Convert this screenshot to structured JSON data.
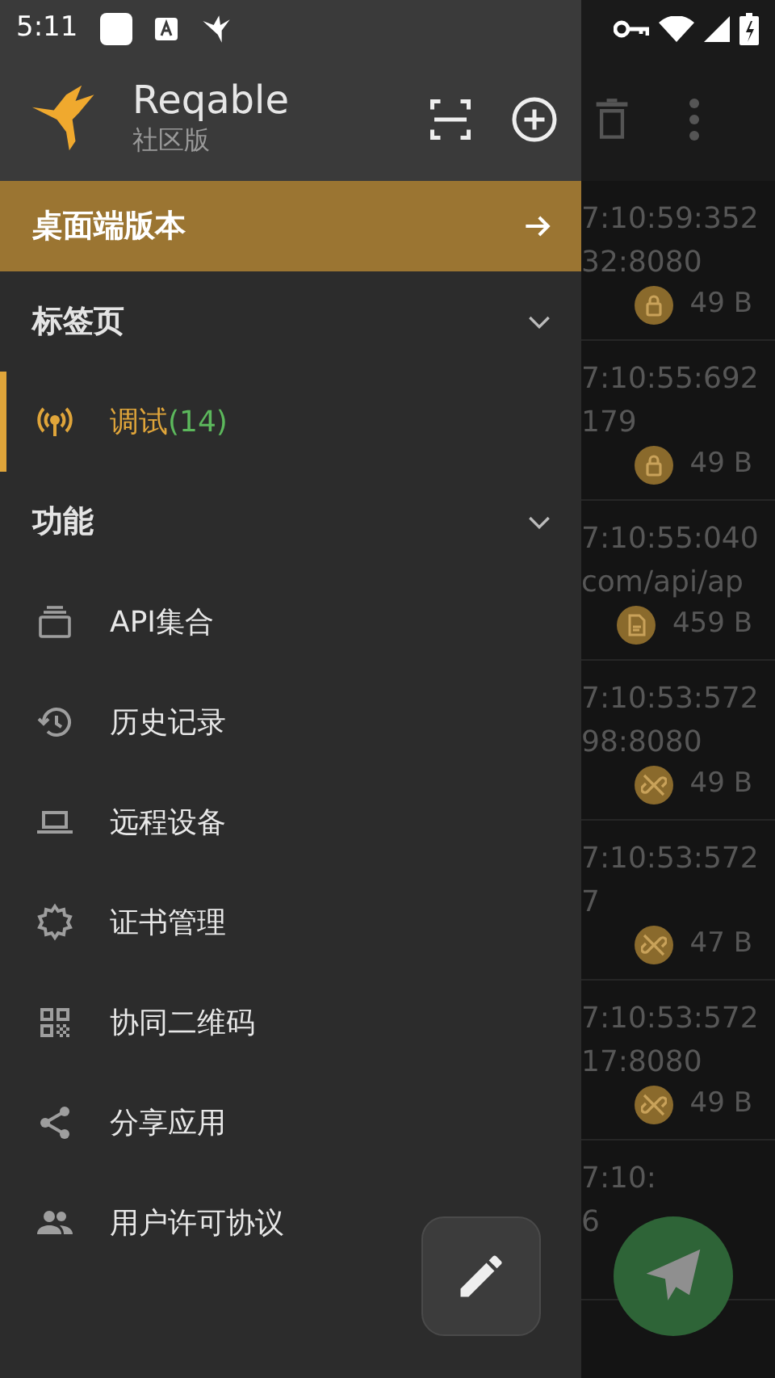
{
  "status_bar": {
    "time": "5:11"
  },
  "drawer": {
    "app_name": "Reqable",
    "edition": "社区版",
    "banner": {
      "label": "桌面端版本"
    },
    "sections": [
      {
        "title": "标签页",
        "expanded": true,
        "items": [
          {
            "kind": "antenna",
            "label": "调试",
            "count": "(14)",
            "selected": true
          }
        ]
      },
      {
        "title": "功能",
        "expanded": true,
        "items": [
          {
            "kind": "stack",
            "label": "API集合",
            "selected": false
          },
          {
            "kind": "history",
            "label": "历史记录",
            "selected": false
          },
          {
            "kind": "laptop",
            "label": "远程设备",
            "selected": false
          },
          {
            "kind": "gear",
            "label": "证书管理",
            "selected": false
          },
          {
            "kind": "qr",
            "label": "协同二维码",
            "selected": false
          },
          {
            "kind": "share",
            "label": "分享应用",
            "selected": false
          },
          {
            "kind": "people",
            "label": "用户许可协议",
            "selected": false
          }
        ]
      }
    ]
  },
  "requests": [
    {
      "time": "7:10:59:352",
      "host": "32:8080",
      "kind": "lock",
      "size": "49 B"
    },
    {
      "time": "7:10:55:692",
      "host": "179",
      "kind": "lock",
      "size": "49 B"
    },
    {
      "time": "7:10:55:040",
      "host": "com/api/ap",
      "kind": "file",
      "size": "459 B"
    },
    {
      "time": "7:10:53:572",
      "host": "98:8080",
      "kind": "unlink",
      "size": "49 B"
    },
    {
      "time": "7:10:53:572",
      "host": "7",
      "kind": "unlink",
      "size": "47 B"
    },
    {
      "time": "7:10:53:572",
      "host": "17:8080",
      "kind": "unlink",
      "size": "49 B"
    },
    {
      "time": "7:10:",
      "host": "6",
      "kind": "none"
    }
  ]
}
